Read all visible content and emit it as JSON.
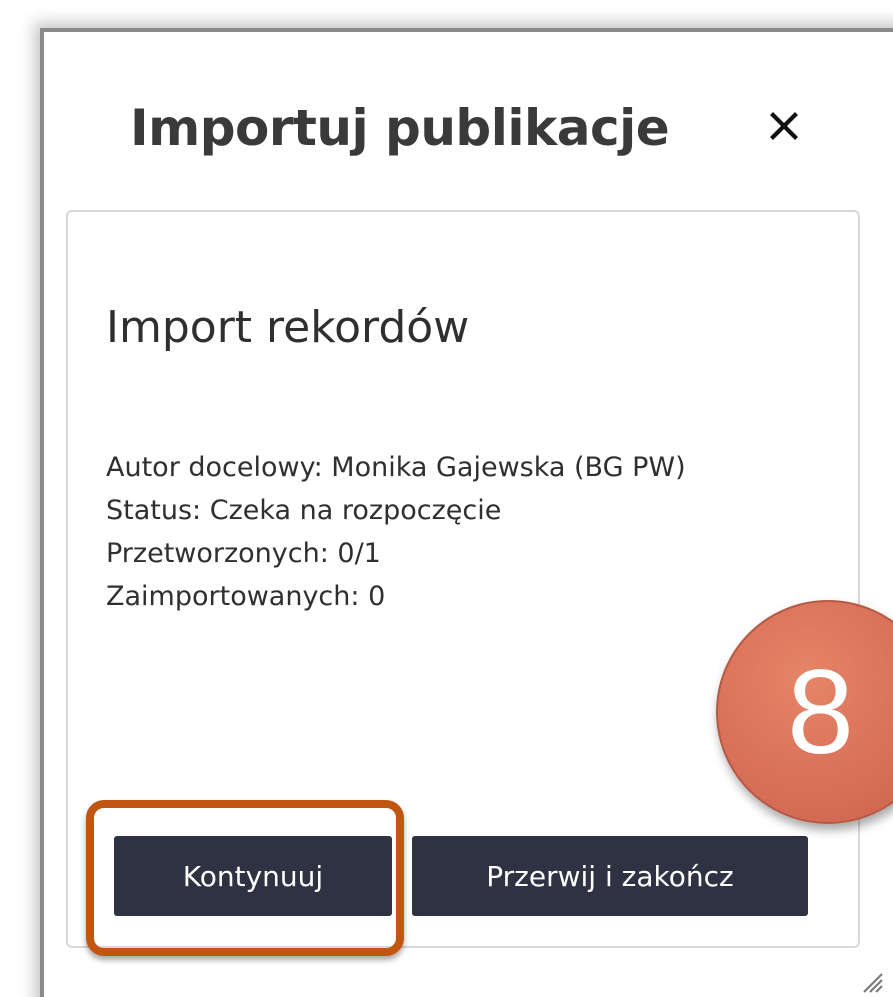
{
  "dialog": {
    "title": "Importuj publikacje",
    "close_icon": "close-icon"
  },
  "panel": {
    "title": "Import rekordów",
    "info": {
      "target_author": "Autor docelowy: Monika Gajewska (BG PW)",
      "status": "Status: Czeka na rozpoczęcie",
      "processed": "Przetworzonych: 0/1",
      "imported": "Zaimportowanych: 0"
    }
  },
  "buttons": {
    "continue_label": "Kontynuuj",
    "abort_label": "Przerwij i zakończ"
  },
  "annotation": {
    "step_number": "8",
    "badge_color": "#d8705a",
    "highlight_color": "#c0560f"
  },
  "colors": {
    "button_bg": "#2e3242",
    "button_text": "#ffffff",
    "title_text": "#3a3a3a"
  }
}
